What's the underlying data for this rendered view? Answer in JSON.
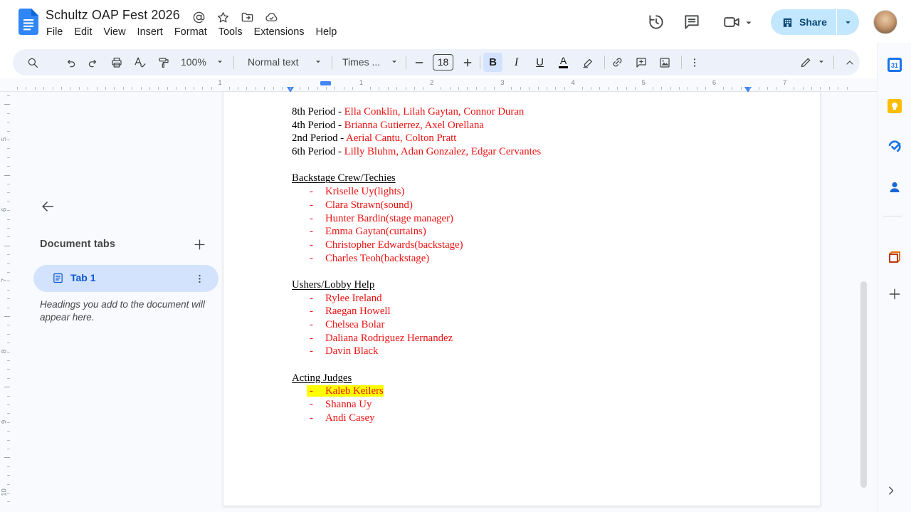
{
  "header": {
    "doc_title": "Schultz OAP Fest 2026",
    "menus": [
      "File",
      "Edit",
      "View",
      "Insert",
      "Format",
      "Tools",
      "Extensions",
      "Help"
    ],
    "share_label": "Share"
  },
  "toolbar": {
    "zoom_value": "100%",
    "paragraph_style": "Normal text",
    "font_name": "Times ...",
    "font_size": "18"
  },
  "rulers": {
    "horizontal_numbers": [
      "1",
      "1",
      "2",
      "3",
      "4",
      "5",
      "6",
      "7"
    ],
    "vertical_numbers": [
      "5",
      "6",
      "7",
      "8",
      "9",
      "10"
    ]
  },
  "tabs_panel": {
    "title": "Document tabs",
    "tab_label": "Tab 1",
    "hint": "Headings you add to the document will appear here."
  },
  "document": {
    "period_lines": [
      {
        "label": "8th Period - ",
        "names": "Ella Conklin, Lilah Gaytan, Connor Duran"
      },
      {
        "label": "4th Period - ",
        "names": "Brianna Gutierrez, Axel Orellana"
      },
      {
        "label": "2nd Period - ",
        "names": "Aerial Cantu, Colton Pratt"
      },
      {
        "label": "6th Period - ",
        "names": "Lilly Bluhm, Adan Gonzalez, Edgar Cervantes"
      }
    ],
    "sections": [
      {
        "heading": "Backstage Crew/Techies",
        "items": [
          {
            "text": "Kriselle Uy(lights)"
          },
          {
            "text": "Clara Strawn(sound)"
          },
          {
            "text": "Hunter Bardin(stage manager)"
          },
          {
            "text": "Emma Gaytan(curtains)"
          },
          {
            "text": "Christopher Edwards(backstage)"
          },
          {
            "text": "Charles Teoh(backstage)"
          }
        ]
      },
      {
        "heading": "Ushers/Lobby Help",
        "items": [
          {
            "text": "Rylee Ireland"
          },
          {
            "text": "Raegan Howell"
          },
          {
            "text": "Chelsea Bolar"
          },
          {
            "text": "Daliana Rodriguez Hernandez"
          },
          {
            "text": "Davin Black"
          }
        ]
      },
      {
        "heading": "Acting Judges",
        "items": [
          {
            "text": "Kaleb Keilers",
            "highlight": true
          },
          {
            "text": "Shanna Uy"
          },
          {
            "text": "Andi Casey"
          }
        ]
      }
    ]
  },
  "colors": {
    "red_text": "#ee1111",
    "highlight_yellow": "#ffff00",
    "accent_blue": "#0b57d0",
    "share_button_bg": "#c2e7ff",
    "active_tab_pill": "#d3e3fd",
    "toolbar_bg": "#edf2fa",
    "canvas_bg": "#f8fafd"
  }
}
